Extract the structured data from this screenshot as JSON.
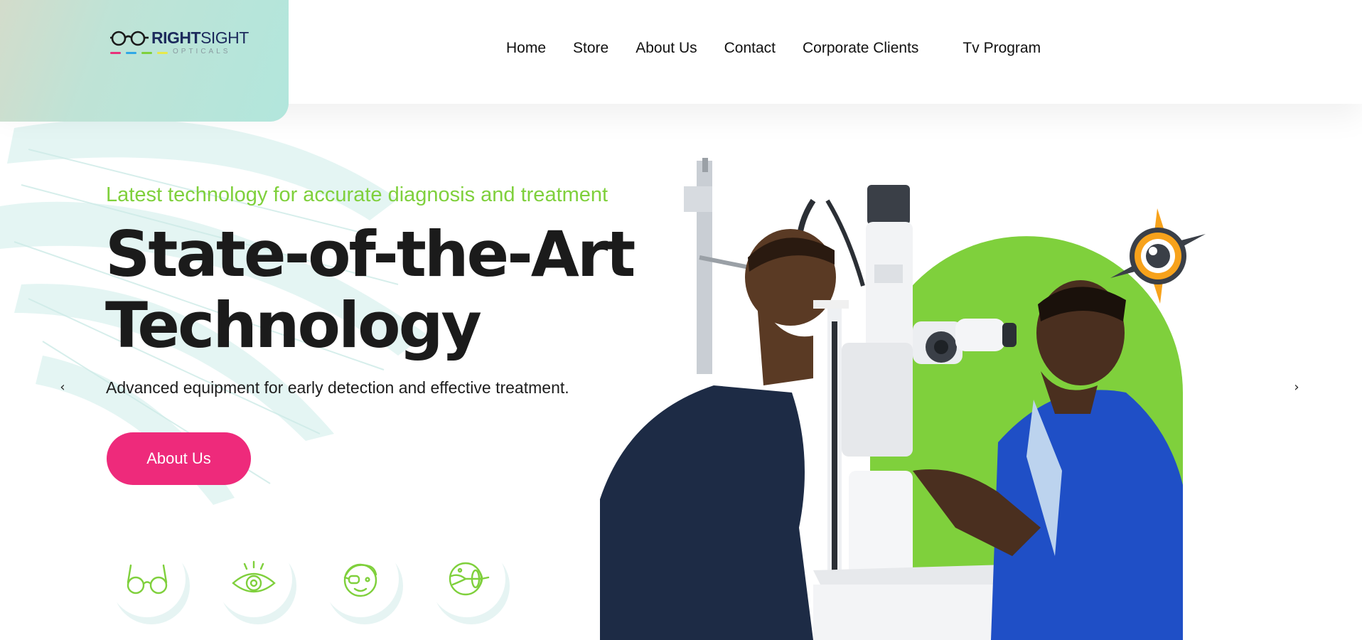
{
  "header": {
    "logo": {
      "brand_bold": "RIGHT",
      "brand_light": "SIGHT",
      "sub": "OPTICALS",
      "dash_colors": [
        "#e8317b",
        "#2fa8e6",
        "#7fd03c",
        "#e7e94a"
      ]
    },
    "nav": [
      {
        "label": "Home"
      },
      {
        "label": "Store"
      },
      {
        "label": "About Us"
      },
      {
        "label": "Contact"
      },
      {
        "label": "Corporate Clients"
      },
      {
        "label": "Tv Program"
      }
    ]
  },
  "hero": {
    "tagline": "Latest technology for accurate diagnosis and treatment",
    "headline_line1": "State-of-the-Art",
    "headline_line2": "Technology",
    "description": "Advanced equipment for early detection and effective treatment.",
    "cta_label": "About Us",
    "prev_arrow": "‹",
    "next_arrow": "›"
  },
  "services": [
    {
      "icon": "glasses-icon"
    },
    {
      "icon": "eye-icon"
    },
    {
      "icon": "child-eyepatch-icon"
    },
    {
      "icon": "eyeball-anatomy-icon"
    }
  ],
  "colors": {
    "accent_green": "#7fd03c",
    "cta_pink": "#ee2a7b",
    "badge_orange": "#f7a21b",
    "jacket_blue": "#1f4fc6"
  }
}
